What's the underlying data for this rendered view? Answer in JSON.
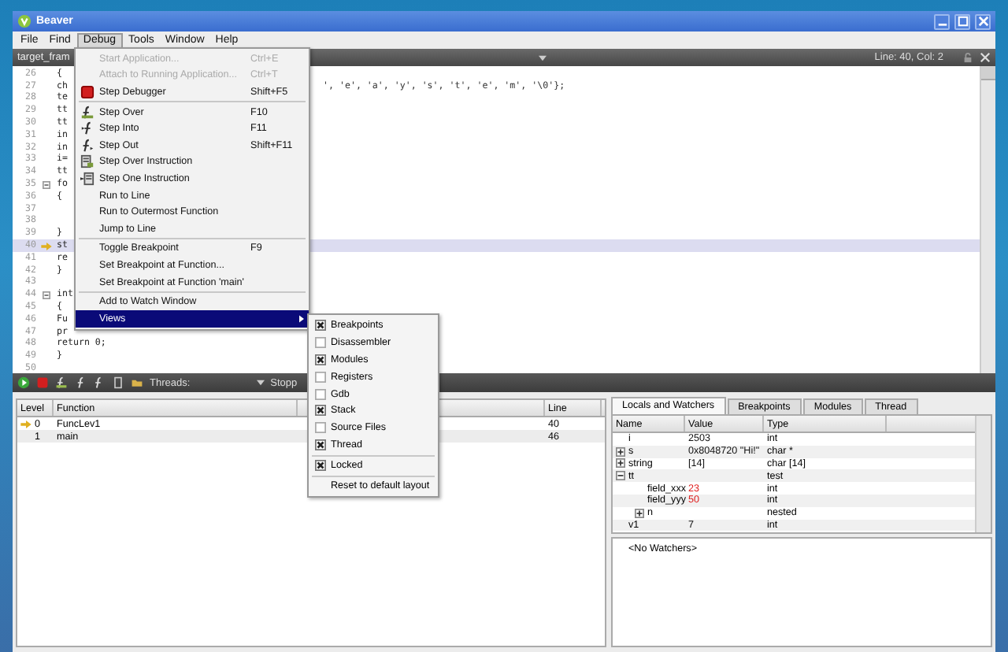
{
  "window": {
    "title": "Beaver"
  },
  "menubar": [
    {
      "label": "File",
      "selected": false
    },
    {
      "label": "Find",
      "selected": false
    },
    {
      "label": "Debug",
      "selected": true
    },
    {
      "label": "Tools",
      "selected": false
    },
    {
      "label": "Window",
      "selected": false
    },
    {
      "label": "Help",
      "selected": false
    }
  ],
  "editor": {
    "tab": "target_fram",
    "position": "Line: 40, Col: 2",
    "lines": [
      {
        "number": "26",
        "text": "{",
        "current": false,
        "foldable": false
      },
      {
        "number": "27",
        "text": "ch",
        "tail": "', 'e', 'a', 'y', 's', 't', 'e', 'm', '\\0'};",
        "current": false,
        "foldable": false
      },
      {
        "number": "28",
        "text": "te",
        "current": false,
        "foldable": false
      },
      {
        "number": "29",
        "text": "tt",
        "current": false,
        "foldable": false
      },
      {
        "number": "30",
        "text": "tt",
        "current": false,
        "foldable": false
      },
      {
        "number": "31",
        "text": "in",
        "current": false,
        "foldable": false
      },
      {
        "number": "32",
        "text": "in",
        "current": false,
        "foldable": false
      },
      {
        "number": "33",
        "text": "i=",
        "current": false,
        "foldable": false
      },
      {
        "number": "34",
        "text": "tt",
        "current": false,
        "foldable": false
      },
      {
        "number": "35",
        "text": "fo",
        "current": false,
        "foldable": true
      },
      {
        "number": "36",
        "text": "{",
        "current": false,
        "foldable": false
      },
      {
        "number": "37",
        "current": false,
        "foldable": false
      },
      {
        "number": "38",
        "current": false,
        "foldable": false
      },
      {
        "number": "39",
        "text": "}",
        "current": false,
        "foldable": false
      },
      {
        "number": "40",
        "text": "st",
        "current": true,
        "foldable": false
      },
      {
        "number": "41",
        "text": "re",
        "current": false,
        "foldable": false
      },
      {
        "number": "42",
        "text": "}",
        "current": false,
        "foldable": false
      },
      {
        "number": "43",
        "current": false,
        "foldable": false
      },
      {
        "number": "44",
        "text": "int",
        "current": false,
        "foldable": true
      },
      {
        "number": "45",
        "text": "{",
        "current": false,
        "foldable": false
      },
      {
        "number": "46",
        "text": "Fu",
        "current": false,
        "foldable": false
      },
      {
        "number": "47",
        "text": "pr",
        "current": false,
        "foldable": false
      },
      {
        "number": "48",
        "text": "return 0;",
        "current": false,
        "foldable": false
      },
      {
        "number": "49",
        "text": "}",
        "current": false,
        "foldable": false
      },
      {
        "number": "50",
        "current": false,
        "foldable": false
      }
    ]
  },
  "debug_toolbar": {
    "threads_label": "Threads:",
    "threads_value": "Stopp"
  },
  "stack": {
    "columns": [
      "Level",
      "Function",
      "Line"
    ],
    "rows": [
      {
        "level": "0",
        "function": "FuncLev1",
        "line": "40",
        "current": true
      },
      {
        "level": "1",
        "function": "main",
        "line": "46",
        "current": false
      }
    ]
  },
  "inspector": {
    "tabs": [
      {
        "label": "Locals and Watchers",
        "selected": true
      },
      {
        "label": "Breakpoints",
        "selected": false
      },
      {
        "label": "Modules",
        "selected": false
      },
      {
        "label": "Thread",
        "selected": false
      }
    ],
    "columns": [
      "Name",
      "Value",
      "Type"
    ],
    "locals": [
      {
        "name": "i",
        "value": "2503",
        "type": "int",
        "changed": false
      },
      {
        "name": "s",
        "value": "0x8048720 \"Hi!\"",
        "type": "char *",
        "expanded": false,
        "changed": false
      },
      {
        "name": "string",
        "value": "[14]",
        "type": "char [14]",
        "expanded": false,
        "changed": false
      },
      {
        "name": "tt",
        "type": "test",
        "expanded": true,
        "children": [
          {
            "name": "field_xxx",
            "value": "23",
            "type": "int",
            "changed": true
          },
          {
            "name": "field_yyy",
            "value": "50",
            "type": "int",
            "changed": true
          },
          {
            "name": "n",
            "type": "nested",
            "expanded": false
          }
        ]
      },
      {
        "name": "v1",
        "value": "7",
        "type": "int",
        "changed": false
      }
    ],
    "watchers": "<No Watchers>"
  },
  "debug_menu": {
    "groups": [
      [
        {
          "label": "Start Application...",
          "shortcut": "Ctrl+E",
          "disabled": true,
          "selected": false,
          "kind": "plain"
        },
        {
          "label": "Attach to Running Application...",
          "shortcut": "Ctrl+T",
          "disabled": true,
          "selected": false,
          "kind": "plain"
        },
        {
          "label": "Step Debugger",
          "shortcut": "Shift+F5",
          "disabled": false,
          "selected": false,
          "kind": "stop"
        }
      ],
      [
        {
          "label": "Step Over",
          "shortcut": "F10",
          "disabled": false,
          "selected": false,
          "kind": "step-over"
        },
        {
          "label": "Step Into",
          "shortcut": "F11",
          "disabled": false,
          "selected": false,
          "kind": "step-into"
        },
        {
          "label": "Step Out",
          "shortcut": "Shift+F11",
          "disabled": false,
          "selected": false,
          "kind": "step-out"
        },
        {
          "label": "Step Over Instruction",
          "disabled": false,
          "selected": false,
          "kind": "step-over-instruction"
        },
        {
          "label": "Step One Instruction",
          "disabled": false,
          "selected": false,
          "kind": "step-instruction"
        },
        {
          "label": "Run to Line",
          "disabled": false,
          "selected": false,
          "kind": "plain"
        },
        {
          "label": "Run to Outermost Function",
          "disabled": false,
          "selected": false,
          "kind": "plain"
        },
        {
          "label": "Jump to Line",
          "disabled": false,
          "selected": false,
          "kind": "plain"
        }
      ],
      [
        {
          "label": "Toggle Breakpoint",
          "shortcut": "F9",
          "disabled": false,
          "selected": false,
          "kind": "plain"
        },
        {
          "label": "Set Breakpoint at Function...",
          "disabled": false,
          "selected": false,
          "kind": "plain"
        },
        {
          "label": "Set Breakpoint at Function 'main'",
          "disabled": false,
          "selected": false,
          "kind": "plain"
        }
      ],
      [
        {
          "label": "Add to Watch Window",
          "disabled": false,
          "selected": false,
          "kind": "plain"
        },
        {
          "label": "Views",
          "disabled": false,
          "selected": true,
          "kind": "submenu"
        }
      ]
    ]
  },
  "views_menu": {
    "groups": [
      [
        {
          "label": "Breakpoints",
          "kind": "check",
          "checked": true
        },
        {
          "label": "Disassembler",
          "kind": "check",
          "checked": false
        },
        {
          "label": "Modules",
          "kind": "check",
          "checked": true
        },
        {
          "label": "Registers",
          "kind": "check",
          "checked": false
        },
        {
          "label": "Gdb",
          "kind": "check",
          "checked": false
        },
        {
          "label": "Stack",
          "kind": "check",
          "checked": true
        },
        {
          "label": "Source Files",
          "kind": "check",
          "checked": false
        },
        {
          "label": "Thread",
          "kind": "check",
          "checked": true
        }
      ],
      [
        {
          "label": "Locked",
          "kind": "check",
          "checked": true
        }
      ],
      [
        {
          "label": "Reset to default layout",
          "kind": "action"
        }
      ]
    ]
  }
}
